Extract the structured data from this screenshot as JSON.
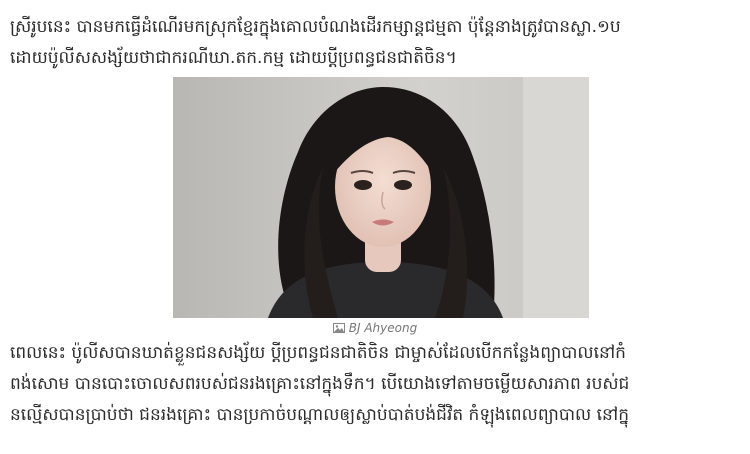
{
  "article": {
    "top_paragraph": [
      "ស្រីរូបនេះ បានមកធ្វើដំណើរមកស្រុកខ្មែរក្នុងគោលបំណងដើរកម្សាន្តជម្មតា ប៉ុន្តែនាងត្រូវបានស្លា.១ប",
      "ដោយប៉ូលីសសង្ស័យថាជាករណីឃា.តក.កម្ម ដោយប្ដីប្រពន្ធជនជាតិចិន។"
    ],
    "figure": {
      "caption": "BJ Ahyeong",
      "caption_icon": "image-icon"
    },
    "bottom_paragraph": [
      "ពេលនេះ ប៉ូលីសបានឃាត់ខ្លួនជនសង្ស័យ ប្ដីប្រពន្ធជនជាតិចិន ជាម្ចាស់ដែលបើកកន្លែងព្យាបាលនៅកំ",
      "ពង់សោម បានបោះចោលសពរបស់ជនរងគ្រោះនៅក្នុងទឹក។ បើយោងទៅតាមចម្លើយសារភាព របស់ជ",
      "នល្មើសបានប្រាប់ថា ជនរងគ្រោះ បានប្រកាច់បណ្ដាលឲ្យស្លាប់បាត់បង់ជីវិត កំឡុងពេលព្យាបាល នៅក្នុ"
    ]
  }
}
